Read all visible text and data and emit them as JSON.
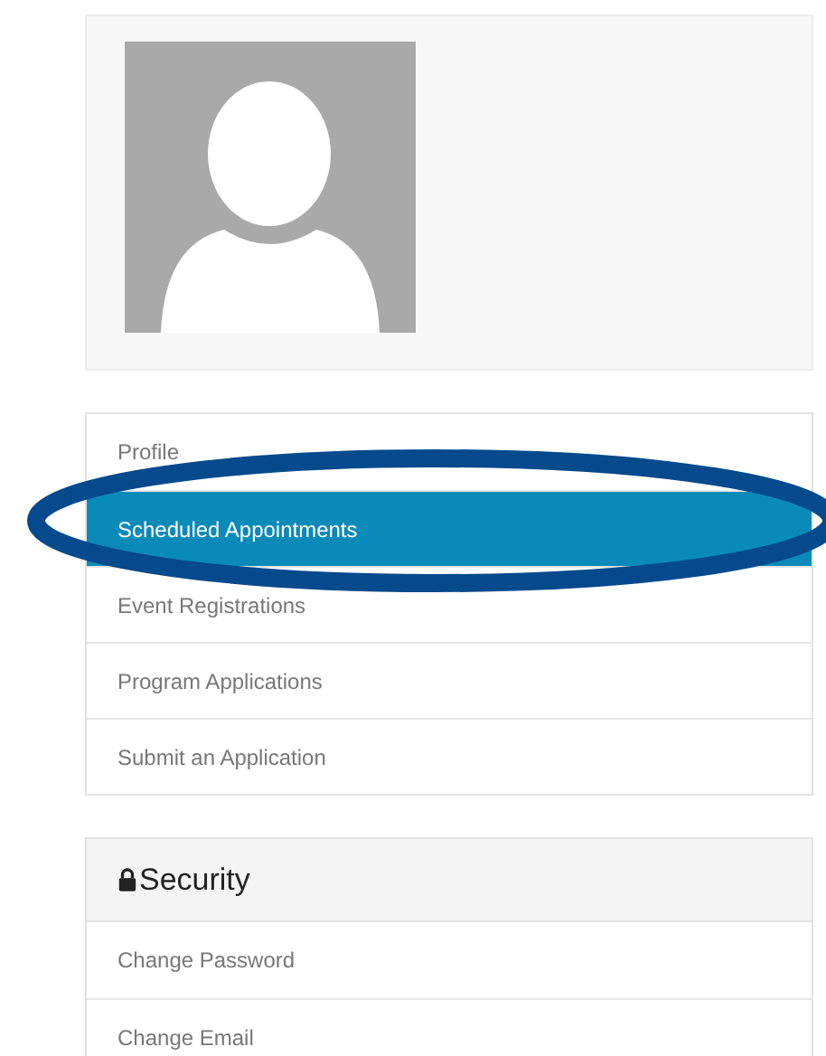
{
  "profile_card": {
    "avatar": {
      "kind": "placeholder"
    }
  },
  "menu": [
    {
      "label": "Profile",
      "selected": false
    },
    {
      "label": "Scheduled Appointments",
      "selected": true
    },
    {
      "label": "Event Registrations",
      "selected": false
    },
    {
      "label": "Program Applications",
      "selected": false
    },
    {
      "label": "Submit an Application",
      "selected": false
    }
  ],
  "annotation": {
    "kind": "ellipse",
    "color": "#054a8c"
  },
  "security": {
    "title": "Security",
    "items": [
      "Change Password",
      "Change Email"
    ]
  }
}
